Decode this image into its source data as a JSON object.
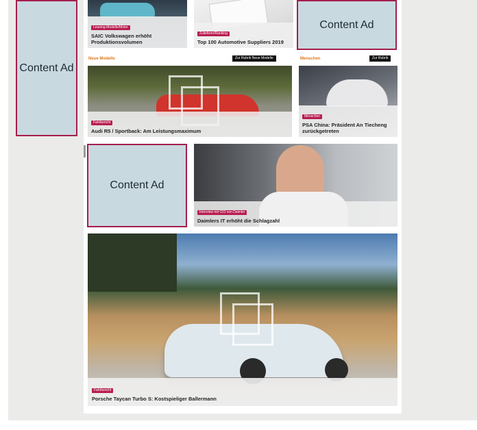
{
  "ads": {
    "label_left": "Content Ad",
    "label_top": "Content Ad",
    "label_mid": "Content Ad"
  },
  "sections": {
    "new_models": {
      "title": "Neue Modelle",
      "button": "Zur Rubrik Neue Modelle"
    },
    "people": {
      "title": "Menschen",
      "button": "Zur Rubrik"
    }
  },
  "cards": [
    {
      "tag": "Leasing-Modelle/Motor",
      "headline": "SAIC Volkswagen erhöht Produktionsvolumen"
    },
    {
      "tag": "Zulieferer/Ranking",
      "headline": "Top 100 Automotive Suppliers 2019"
    },
    {
      "tag": "Fahrbericht",
      "headline": "Audi R5 / Sportback: Am Leistungsmaximum"
    },
    {
      "tag": "Menschen",
      "headline": "PSA China: Präsident An Tiecheng zurückgetreten"
    },
    {
      "tag": "Interview mit CIO von Daimler",
      "headline": "Daimlers IT erhöht die Schlagzahl"
    },
    {
      "tag": "Fahrbericht",
      "headline": "Porsche Taycan Turbo S: Kostspieliger Ballermann"
    }
  ]
}
